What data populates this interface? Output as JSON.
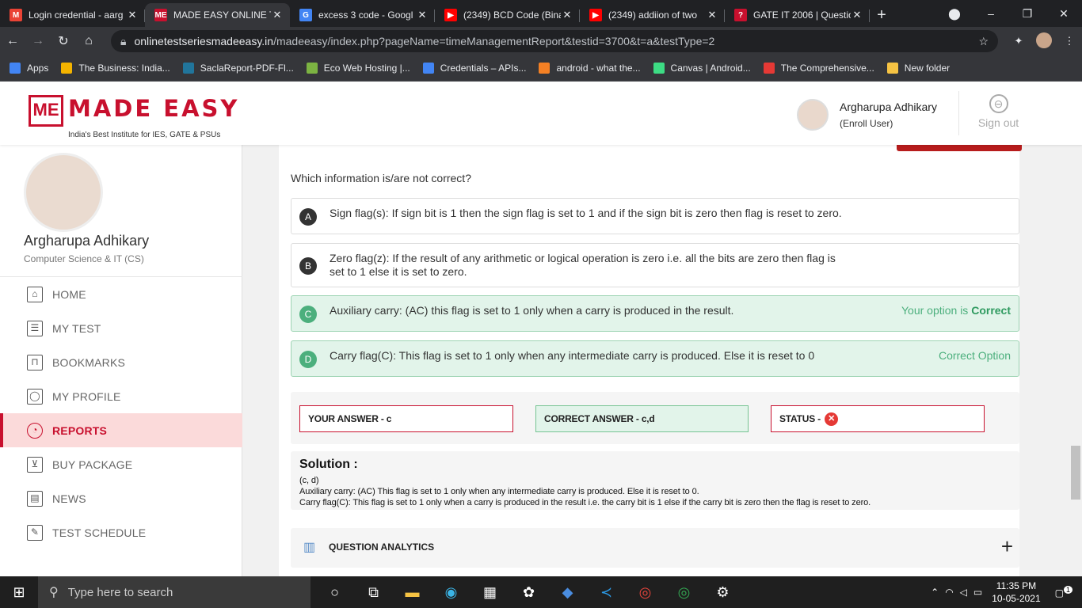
{
  "browser": {
    "tabs": [
      {
        "title": "Login credential - aarg",
        "favicon_color": "#ea4335",
        "favicon_text": "M",
        "active": false
      },
      {
        "title": "MADE EASY ONLINE T",
        "favicon_color": "#c8102e",
        "favicon_text": "ME",
        "active": true
      },
      {
        "title": "excess 3 code - Googl",
        "favicon_color": "#4285f4",
        "favicon_text": "G",
        "active": false
      },
      {
        "title": "(2349) BCD Code (Bina",
        "favicon_color": "#ff0000",
        "favicon_text": "▶",
        "active": false
      },
      {
        "title": "(2349) addiion of two",
        "favicon_color": "#ff0000",
        "favicon_text": "▶",
        "active": false
      },
      {
        "title": "GATE IT 2006 | Questio",
        "favicon_color": "#c8102e",
        "favicon_text": "?",
        "active": false
      }
    ],
    "close_glyph": "✕",
    "new_tab_glyph": "+",
    "url_host": "onlinetestseriesmadeeasy.in",
    "url_path": "/madeeasy/index.php?pageName=timeManagementReport&testid=3700&t=a&testType=2",
    "bookmarks": [
      {
        "label": "Apps",
        "color": "#4285f4"
      },
      {
        "label": "The Business: India...",
        "color": "#f4b400"
      },
      {
        "label": "SaclaReport-PDF-Fl...",
        "color": "#21759b"
      },
      {
        "label": "Eco Web Hosting |...",
        "color": "#7cb342"
      },
      {
        "label": "Credentials – APIs...",
        "color": "#4285f4"
      },
      {
        "label": "android - what the...",
        "color": "#f48024"
      },
      {
        "label": "Canvas | Android...",
        "color": "#3ddc84"
      },
      {
        "label": "The Comprehensive...",
        "color": "#e53935"
      },
      {
        "label": "New folder",
        "color": "#f6c343"
      }
    ]
  },
  "header": {
    "logo_mark": "ME",
    "logo_name": "MADE EASY",
    "logo_tagline": "India's Best Institute for IES, GATE & PSUs",
    "user_name": "Argharupa Adhikary",
    "user_role": "(Enroll User)",
    "signout_label": "Sign out"
  },
  "sidebar": {
    "name": "Argharupa Adhikary",
    "department": "Computer Science & IT (CS)",
    "items": [
      {
        "label": "HOME",
        "icon": "home-icon",
        "glyph": "⌂",
        "active": false
      },
      {
        "label": "MY TEST",
        "icon": "test-icon",
        "glyph": "☰",
        "active": false
      },
      {
        "label": "BOOKMARKS",
        "icon": "bookmark-icon",
        "glyph": "⊓",
        "active": false
      },
      {
        "label": "MY PROFILE",
        "icon": "profile-icon",
        "glyph": "◯",
        "active": false
      },
      {
        "label": "REPORTS",
        "icon": "reports-icon",
        "glyph": "◔",
        "active": true
      },
      {
        "label": "BUY PACKAGE",
        "icon": "cart-icon",
        "glyph": "⊻",
        "active": false
      },
      {
        "label": "NEWS",
        "icon": "news-icon",
        "glyph": "▤",
        "active": false
      },
      {
        "label": "TEST SCHEDULE",
        "icon": "schedule-icon",
        "glyph": "✎",
        "active": false
      }
    ]
  },
  "question": {
    "text": "Which information is/are not correct?",
    "options": [
      {
        "letter": "A",
        "line1": "Sign flag(s): If sign bit is 1 then the sign flag is set to 1 and if the sign bit is zero then flag is reset to zero.",
        "line2": "",
        "state": "normal",
        "note_prefix": "",
        "note_bold": ""
      },
      {
        "letter": "B",
        "line1": "Zero flag(z): If the result of any arithmetic or logical operation is zero i.e. all the bits are zero then flag is",
        "line2": "set to 1 else it is set to zero.",
        "state": "normal",
        "note_prefix": "",
        "note_bold": ""
      },
      {
        "letter": "C",
        "line1": "Auxiliary carry: (AC) this flag is set to 1 only when a carry is produced in the result.",
        "line2": "",
        "state": "green",
        "note_prefix": "Your option is ",
        "note_bold": "Correct"
      },
      {
        "letter": "D",
        "line1": "Carry flag(C): This flag is set to 1 only when any intermediate carry is produced. Else it is reset to 0",
        "line2": "",
        "state": "green",
        "note_prefix": "Correct Option",
        "note_bold": ""
      }
    ]
  },
  "answers": {
    "your_answer": "YOUR ANSWER - c",
    "correct_answer": "CORRECT ANSWER - c,d",
    "status_label": "STATUS -",
    "status_glyph": "✕"
  },
  "solution": {
    "title": "Solution :",
    "lines": [
      "(c, d)",
      "Auxiliary carry: (AC) This flag is set to 1 only when any intermediate carry is produced. Else it is reset to 0.",
      "Carry flag(C): This flag is set to 1 only when a carry is produced in the result i.e. the carry bit is 1 else if the carry bit is zero then the flag is reset to zero."
    ]
  },
  "analytics": {
    "label": "QUESTION ANALYTICS",
    "expand_glyph": "+"
  },
  "taskbar": {
    "search_placeholder": "Type here to search",
    "time": "11:35 PM",
    "date": "10-05-2021",
    "notification_count": "1"
  }
}
